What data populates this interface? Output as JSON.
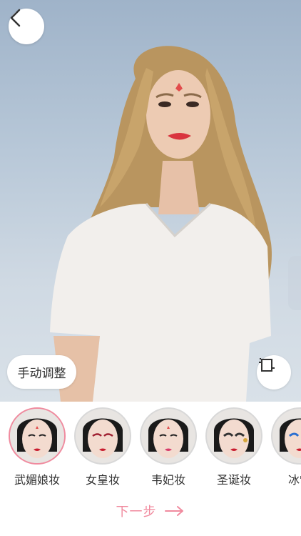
{
  "toolbar": {
    "back_icon": "chevron-left-icon",
    "manual_adjust_label": "手动调整",
    "compare_icon": "crop-compare-icon"
  },
  "makeup_styles": [
    {
      "label": "武媚娘妆",
      "selected": true
    },
    {
      "label": "女皇妆",
      "selected": false
    },
    {
      "label": "韦妃妆",
      "selected": false
    },
    {
      "label": "圣诞妆",
      "selected": false
    },
    {
      "label": "冰雪",
      "selected": false
    }
  ],
  "footer": {
    "next_label": "下一步",
    "next_icon": "arrow-right-icon"
  },
  "colors": {
    "accent": "#f08a9e",
    "text": "#333333"
  }
}
